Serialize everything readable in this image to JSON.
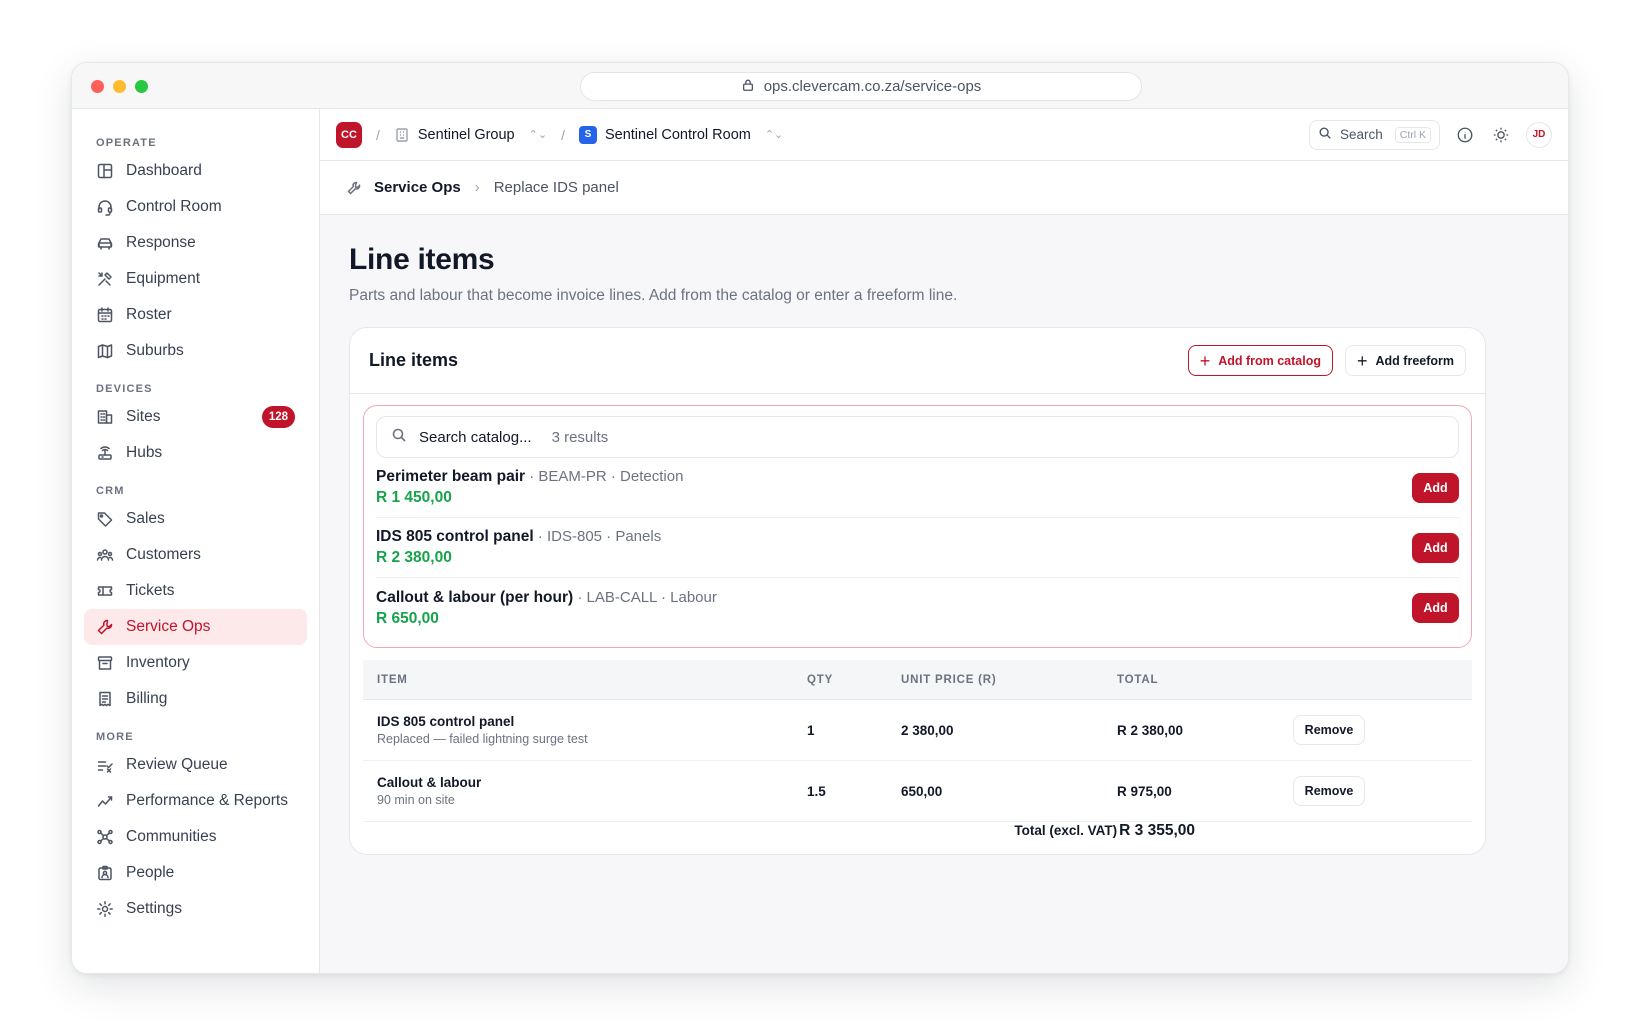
{
  "browser": {
    "url": "ops.clevercam.co.za/service-ops"
  },
  "sidebar": {
    "sections": [
      {
        "label": "OPERATE",
        "items": [
          {
            "label": "Dashboard",
            "icon": "layout-icon"
          },
          {
            "label": "Control Room",
            "icon": "headset-icon"
          },
          {
            "label": "Response",
            "icon": "car-icon"
          },
          {
            "label": "Equipment",
            "icon": "tools-icon"
          },
          {
            "label": "Roster",
            "icon": "calendar-icon"
          },
          {
            "label": "Suburbs",
            "icon": "map-icon"
          }
        ]
      },
      {
        "label": "DEVICES",
        "items": [
          {
            "label": "Sites",
            "icon": "building-icon",
            "badge": "128"
          },
          {
            "label": "Hubs",
            "icon": "router-icon"
          }
        ]
      },
      {
        "label": "CRM",
        "items": [
          {
            "label": "Sales",
            "icon": "tag-icon"
          },
          {
            "label": "Customers",
            "icon": "users-icon"
          },
          {
            "label": "Tickets",
            "icon": "ticket-icon"
          },
          {
            "label": "Service Ops",
            "icon": "wrench-icon",
            "active": true
          },
          {
            "label": "Inventory",
            "icon": "archive-icon"
          },
          {
            "label": "Billing",
            "icon": "receipt-icon"
          }
        ]
      },
      {
        "label": "MORE",
        "items": [
          {
            "label": "Review Queue",
            "icon": "list-check-icon"
          },
          {
            "label": "Performance & Reports",
            "icon": "chart-line-icon"
          },
          {
            "label": "Communities",
            "icon": "network-icon"
          },
          {
            "label": "People",
            "icon": "id-badge-icon"
          },
          {
            "label": "Settings",
            "icon": "gear-icon"
          }
        ]
      }
    ]
  },
  "topbar": {
    "org_initials": "CC",
    "org_name": "Sentinel Group",
    "room_initial": "S",
    "room_name": "Sentinel Control Room",
    "search_label": "Search",
    "search_shortcut": "Ctrl K",
    "user_initials": "JD"
  },
  "pagebar": {
    "section": "Service Ops",
    "current": "Replace IDS panel"
  },
  "page": {
    "title": "Line items",
    "subtitle": "Parts and labour that become invoice lines. Add from the catalog or enter a freeform line."
  },
  "card": {
    "title": "Line items",
    "add_catalog_label": "Add from catalog",
    "add_freeform_label": "Add freeform",
    "catalog_search": {
      "value": "Search catalog...",
      "results": "3 results"
    },
    "catalog_results": [
      {
        "name": "Perimeter beam pair",
        "meta": " · BEAM-PR · Detection",
        "price": "R 1 450,00",
        "add_label": "Add"
      },
      {
        "name": "IDS 805 control panel",
        "meta": " · IDS-805 · Panels",
        "price": "R 2 380,00",
        "add_label": "Add"
      },
      {
        "name": "Callout & labour (per hour)",
        "meta": " · LAB-CALL · Labour",
        "price": "R 650,00",
        "add_label": "Add"
      }
    ],
    "table": {
      "headers": {
        "item": "ITEM",
        "qty": "QTY",
        "unit": "UNIT PRICE (R)",
        "total": "TOTAL"
      },
      "rows": [
        {
          "name": "IDS 805 control panel",
          "note": "Replaced — failed lightning surge test",
          "qty": "1",
          "unit": "2 380,00",
          "total": "R 2 380,00",
          "action": "Remove"
        },
        {
          "name": "Callout & labour",
          "note": "90 min on site",
          "qty": "1.5",
          "unit": "650,00",
          "total": "R 975,00",
          "action": "Remove"
        }
      ]
    },
    "total_label": "Total (excl. VAT)",
    "total_value": "R 3 355,00"
  },
  "colors": {
    "brand": "#c0142a",
    "price": "#16a34a",
    "room_badge": "#2563eb"
  }
}
